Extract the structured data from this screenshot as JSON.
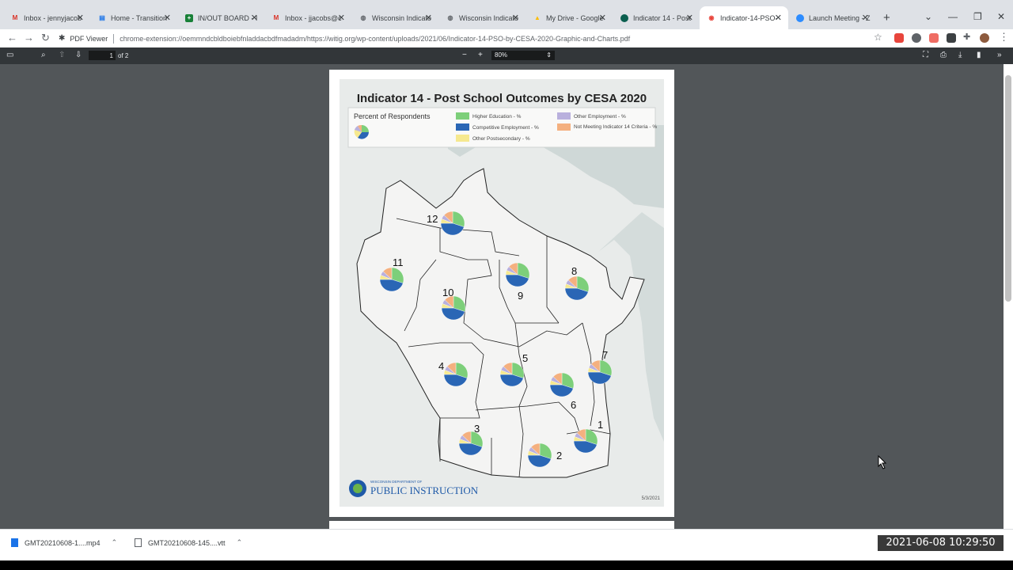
{
  "tabs": [
    {
      "label": "Inbox - jennyjacob",
      "icon": "gmail-icon",
      "color": "#d93025"
    },
    {
      "label": "Home - Transition",
      "icon": "document-icon",
      "color": "#1a73e8"
    },
    {
      "label": "IN/OUT BOARD - I",
      "icon": "sheets-icon",
      "color": "#188038"
    },
    {
      "label": "Inbox - jjacobs@c",
      "icon": "gmail-icon",
      "color": "#d93025"
    },
    {
      "label": "Wisconsin Indicato",
      "icon": "globe-icon",
      "color": "#5f6368"
    },
    {
      "label": "Wisconsin Indicato",
      "icon": "globe-icon",
      "color": "#5f6368"
    },
    {
      "label": "My Drive - Google",
      "icon": "drive-icon",
      "color": "#fbbc04"
    },
    {
      "label": "Indicator 14 - Post",
      "icon": "site-icon",
      "color": "#0b5f4f"
    },
    {
      "label": "Indicator-14-PSO-",
      "icon": "pdf-icon",
      "color": "#e8453c"
    },
    {
      "label": "Launch Meeting - Z",
      "icon": "zoom-icon",
      "color": "#2d8cff"
    }
  ],
  "address_bar": {
    "viewer_label": "PDF Viewer",
    "url": "chrome-extension://oemmndcbldboiebfnladdacbdfmadadm/https://witig.org/wp-content/uploads/2021/06/Indicator-14-PSO-by-CESA-2020-Graphic-and-Charts.pdf"
  },
  "pdf_toolbar": {
    "page_current": "1",
    "page_total": "of 2",
    "zoom": "80%"
  },
  "document": {
    "title": "Indicator 14 - Post School Outcomes by CESA 2020",
    "legend_caption": "Percent of Respondents",
    "legend_items": [
      {
        "label": "Higher Education - %",
        "color": "#7dcf7a"
      },
      {
        "label": "Competitive Employment - %",
        "color": "#2a66b5"
      },
      {
        "label": "Other Postsecondary - %",
        "color": "#f6e98f"
      },
      {
        "label": "Other Employment - %",
        "color": "#b9b0dd"
      },
      {
        "label": "Not Meeting Indicator 14 Criteria - %",
        "color": "#f4b07f"
      }
    ],
    "cesa_labels": [
      "1",
      "2",
      "3",
      "4",
      "5",
      "6",
      "7",
      "8",
      "9",
      "10",
      "11",
      "12"
    ],
    "logo_small_text": "WISCONSIN DEPARTMENT OF",
    "logo_text": "PUBLIC INSTRUCTION",
    "date": "5/3/2021"
  },
  "downloads": [
    {
      "name": "GMT20210608-1....mp4"
    },
    {
      "name": "GMT20210608-145....vtt"
    }
  ],
  "overlay_timestamp": "2021-06-08 10:29:50"
}
